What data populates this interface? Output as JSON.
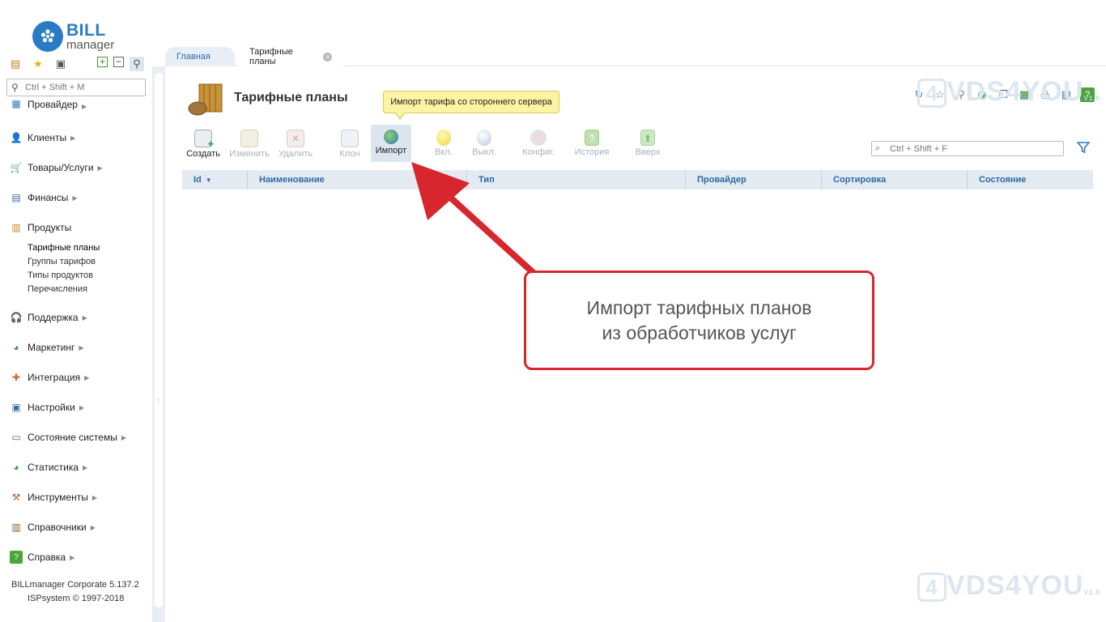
{
  "logo": {
    "name": "BILL",
    "sub": "manager"
  },
  "sidebar": {
    "search_placeholder": "Ctrl + Shift + M",
    "items": [
      {
        "label": "Провайдер",
        "icon": "provider-icon"
      },
      {
        "label": "Клиенты",
        "icon": "clients-icon"
      },
      {
        "label": "Товары/Услуги",
        "icon": "cart-icon"
      },
      {
        "label": "Финансы",
        "icon": "finance-icon"
      },
      {
        "label": "Продукты",
        "icon": "products-icon"
      },
      {
        "label": "Поддержка",
        "icon": "support-icon"
      },
      {
        "label": "Маркетинг",
        "icon": "marketing-icon"
      },
      {
        "label": "Интеграция",
        "icon": "integration-icon"
      },
      {
        "label": "Настройки",
        "icon": "settings-icon"
      },
      {
        "label": "Состояние системы",
        "icon": "system-state-icon"
      },
      {
        "label": "Статистика",
        "icon": "statistics-icon"
      },
      {
        "label": "Инструменты",
        "icon": "tools-icon"
      },
      {
        "label": "Справочники",
        "icon": "references-icon"
      },
      {
        "label": "Справка",
        "icon": "help-icon"
      }
    ],
    "products_sub": [
      "Тарифные планы",
      "Группы тарифов",
      "Типы продуктов",
      "Перечисления"
    ],
    "footer_version": "BILLmanager Corporate 5.137.2",
    "footer_copy": "ISPsystem © 1997-2018"
  },
  "tabs": {
    "main": "Главная",
    "active": "Тарифные планы"
  },
  "page": {
    "title": "Тарифные планы",
    "tooltip": "Импорт тарифа со стороннего сервера"
  },
  "toolbar": {
    "create": "Создать",
    "edit": "Изменить",
    "delete": "Удалить",
    "clone": "Клон",
    "import": "Импорт",
    "on": "Вкл.",
    "off": "Выкл.",
    "config": "Конфиг.",
    "history": "История",
    "up": "Вверх"
  },
  "grid": {
    "search_placeholder": "Ctrl + Shift + F",
    "columns": [
      "Id",
      "Наименование",
      "Тип",
      "Провайдер",
      "Сортировка",
      "Состояние"
    ]
  },
  "annotation": {
    "line1": "Импорт тарифных планов",
    "line2": "из обработчиков услуг",
    "color": "#d7262e"
  },
  "watermark": {
    "text": "VDS4YOU",
    "digit": "4",
    "version": "V1.0"
  },
  "colors": {
    "accent": "#2b7bc4",
    "header_bg": "#e3eaf1",
    "tooltip_bg": "#fcf3a3"
  }
}
